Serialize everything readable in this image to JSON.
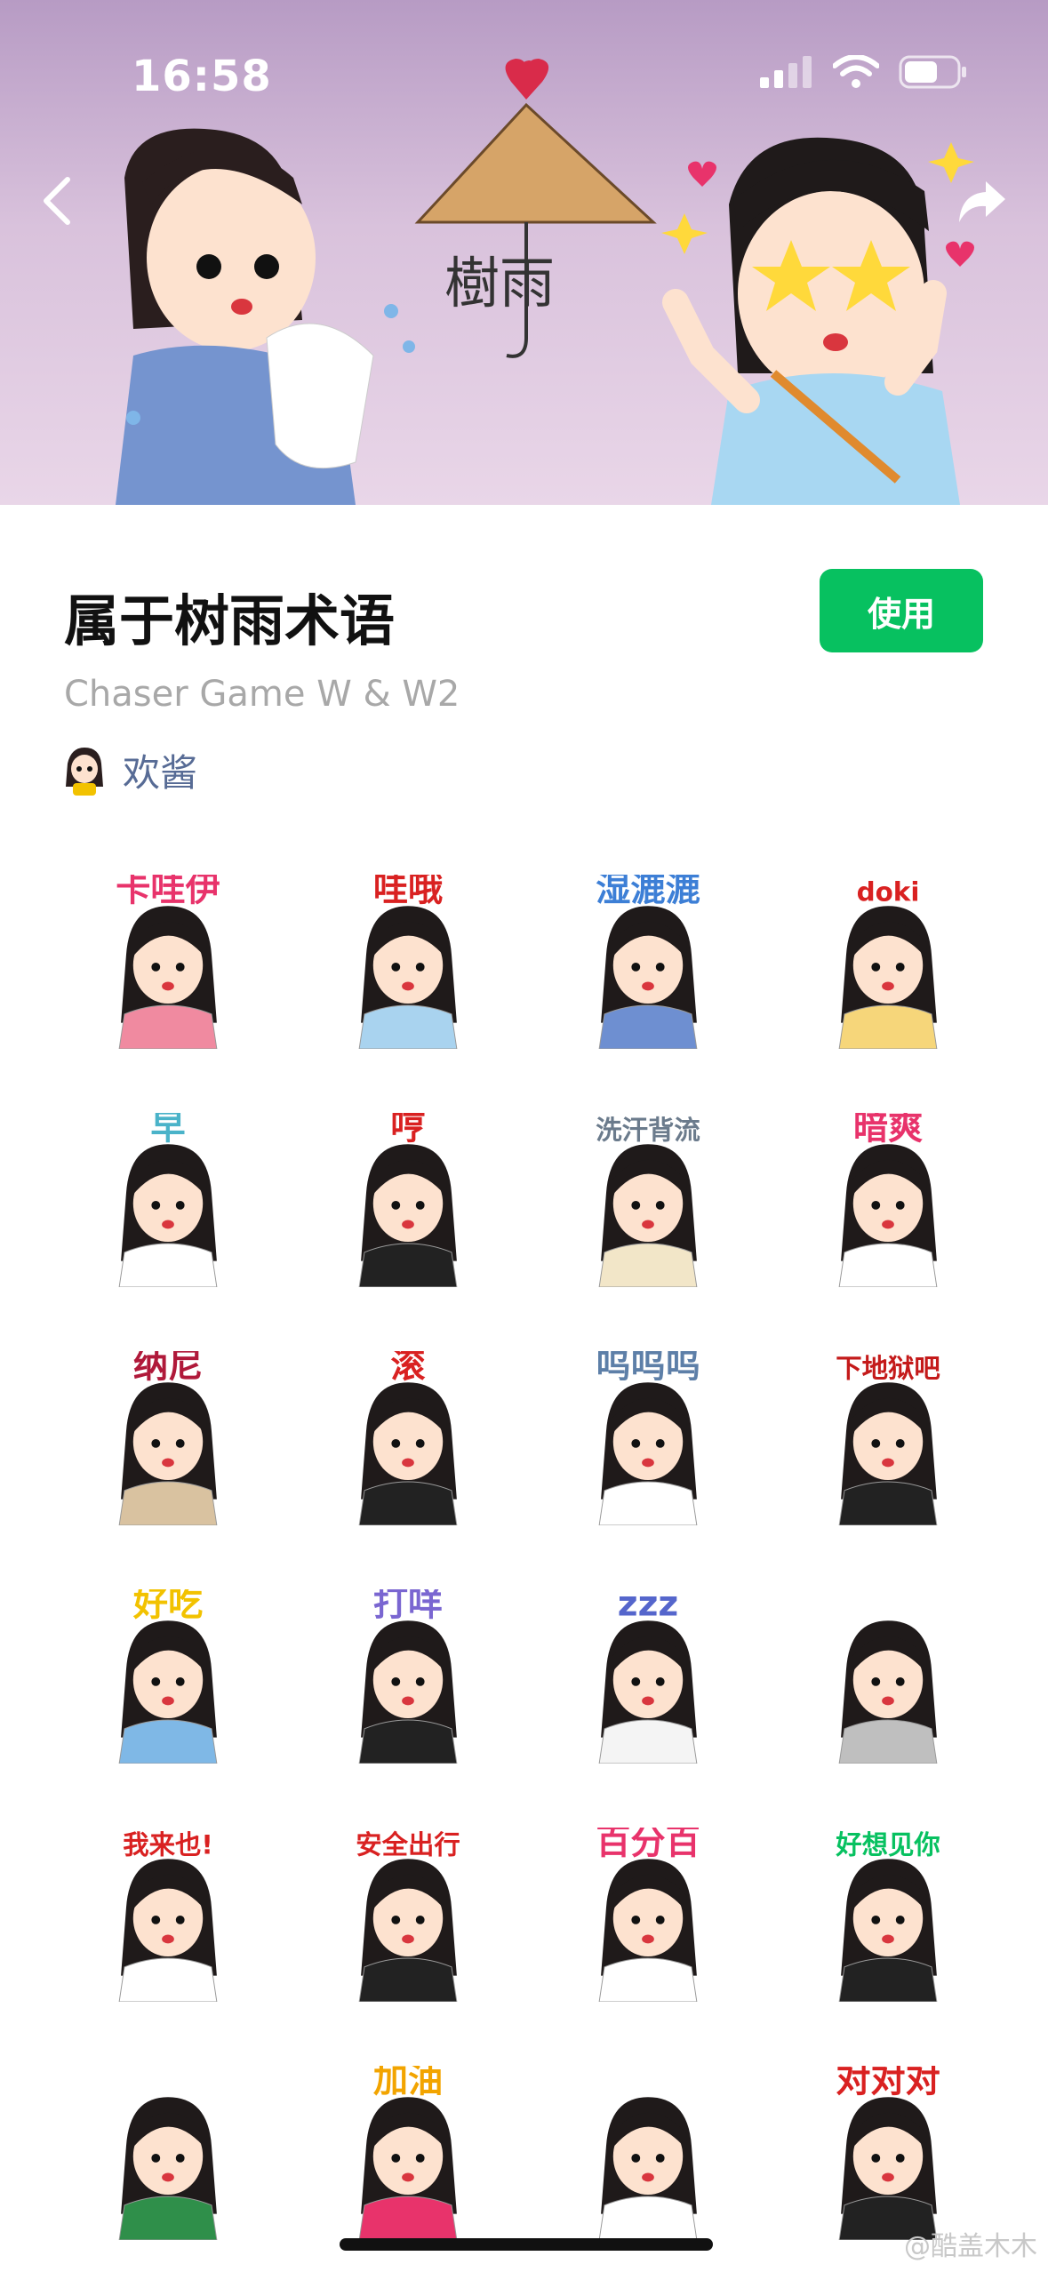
{
  "status_bar": {
    "time": "16:58"
  },
  "banner": {
    "logo_text": "樹雨"
  },
  "pack": {
    "title": "属于树雨术语",
    "subtitle": "Chaser Game W & W2",
    "author": "欢酱",
    "use_label": "使用"
  },
  "stickers": [
    {
      "text": "卡哇伊",
      "accent": "#e8336b",
      "shirt": "#f08aa0"
    },
    {
      "text": "哇哦",
      "accent": "#d92121",
      "shirt": "#a9d3ef"
    },
    {
      "text": "湿漉漉",
      "accent": "#3d7fd6",
      "shirt": "#6e8fd1"
    },
    {
      "text": "doki",
      "accent": "#d92121",
      "shirt": "#f6d67a"
    },
    {
      "text": "早",
      "accent": "#4ab3c9",
      "shirt": "#ffffff"
    },
    {
      "text": "哼",
      "accent": "#d92121",
      "shirt": "#222222"
    },
    {
      "text": "洗汗背流",
      "accent": "#6b7b8c",
      "shirt": "#f2e6c8"
    },
    {
      "text": "暗爽",
      "accent": "#e8336b",
      "shirt": "#ffffff"
    },
    {
      "text": "纳尼",
      "accent": "#b0193a",
      "shirt": "#d9c2a0"
    },
    {
      "text": "滚",
      "accent": "#d92121",
      "shirt": "#222222"
    },
    {
      "text": "呜呜呜",
      "accent": "#5d7fa8",
      "shirt": "#ffffff"
    },
    {
      "text": "下地狱吧",
      "accent": "#c41a1a",
      "shirt": "#222222"
    },
    {
      "text": "好吃",
      "accent": "#f2c200",
      "shirt": "#7fb8e6"
    },
    {
      "text": "打咩",
      "accent": "#7a66d1",
      "shirt": "#222222"
    },
    {
      "text": "zzz",
      "accent": "#5566cc",
      "shirt": "#f4f4f4"
    },
    {
      "text": "",
      "accent": "#666666",
      "shirt": "#bfbfbf"
    },
    {
      "text": "我来也!",
      "accent": "#d92121",
      "shirt": "#ffffff"
    },
    {
      "text": "安全出行",
      "accent": "#d92121",
      "shirt": "#222222"
    },
    {
      "text": "百分百",
      "accent": "#e8336b",
      "shirt": "#ffffff"
    },
    {
      "text": "好想见你",
      "accent": "#07c160",
      "shirt": "#222222"
    },
    {
      "text": "",
      "accent": "#d92121",
      "shirt": "#2f8f4a"
    },
    {
      "text": "加油",
      "accent": "#f2a400",
      "shirt": "#e8336b"
    },
    {
      "text": "",
      "accent": "#b08a2e",
      "shirt": "#ffffff"
    },
    {
      "text": "对对对",
      "accent": "#d92121",
      "shirt": "#222222"
    }
  ],
  "watermark": "@酷盖木木"
}
